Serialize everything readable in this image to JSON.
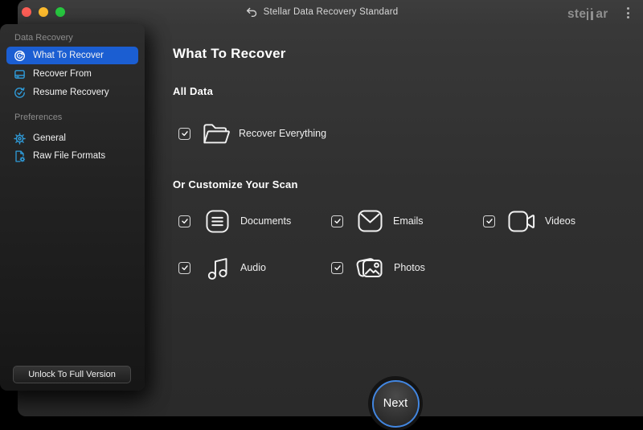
{
  "titlebar": {
    "title": "Stellar Data Recovery Standard",
    "back_icon": "undo-back-arrow-icon",
    "logo": {
      "text": "stellar",
      "part1": "ste",
      "part2": "ar"
    },
    "menu_icon": "vertical-ellipsis-menu-icon",
    "traffic_lights": {
      "close": "#ff5f57",
      "minimize": "#febc2e",
      "zoom": "#28c840"
    }
  },
  "sidebar": {
    "sections": [
      {
        "label": "Data Recovery",
        "items": [
          {
            "label": "What To Recover",
            "icon": "recover-circular-arrow-icon",
            "selected": true
          },
          {
            "label": "Recover From",
            "icon": "drive-icon",
            "selected": false
          },
          {
            "label": "Resume Recovery",
            "icon": "resume-check-circle-icon",
            "selected": false
          }
        ]
      },
      {
        "label": "Preferences",
        "items": [
          {
            "label": "General",
            "icon": "gear-icon",
            "selected": false
          },
          {
            "label": "Raw File Formats",
            "icon": "file-gear-icon",
            "selected": false
          }
        ]
      }
    ],
    "unlock_label": "Unlock To Full Version"
  },
  "main": {
    "heading": "What To Recover",
    "all_data_heading": "All Data",
    "recover_everything": {
      "label": "Recover Everything",
      "icon": "open-folder-icon",
      "checked": true
    },
    "customize_heading": "Or Customize Your Scan",
    "categories": [
      {
        "label": "Documents",
        "icon": "documents-icon",
        "checked": true
      },
      {
        "label": "Emails",
        "icon": "email-envelope-icon",
        "checked": true
      },
      {
        "label": "Videos",
        "icon": "video-camera-icon",
        "checked": true
      },
      {
        "label": "Audio",
        "icon": "music-note-icon",
        "checked": true
      },
      {
        "label": "Photos",
        "icon": "photos-icon",
        "checked": true
      }
    ],
    "next_label": "Next"
  },
  "colors": {
    "selection_blue": "#1b5ed2",
    "sidebar_icon_blue": "#2f9bd9",
    "next_ring_blue": "#4286e0",
    "window_bg": "#2e2e2e",
    "titlebar_bg": "#3a3a3a",
    "desktop_bg": "#000000"
  }
}
